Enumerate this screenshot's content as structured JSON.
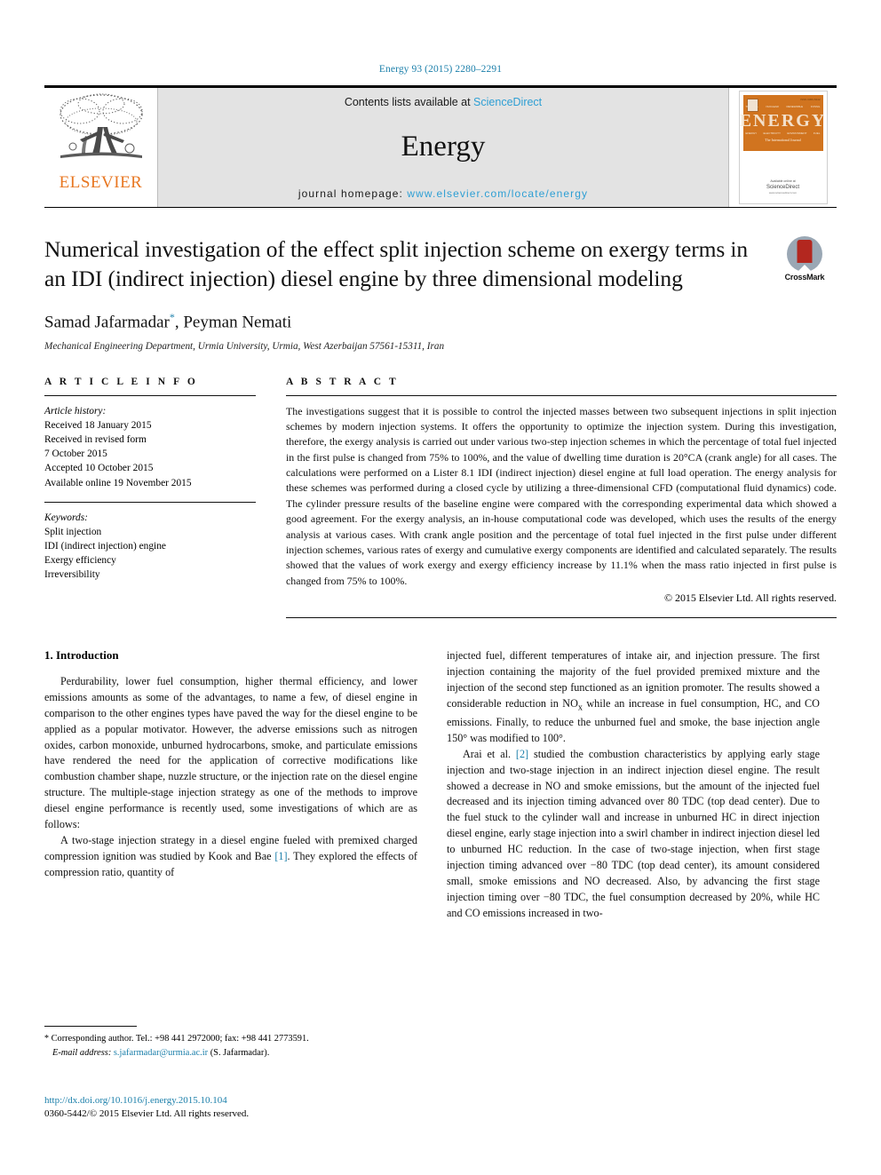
{
  "running_head": "Energy 93 (2015) 2280–2291",
  "masthead": {
    "publisher": "ELSEVIER",
    "contents_prefix": "Contents lists available at ",
    "contents_link": "ScienceDirect",
    "journal_name": "Energy",
    "homepage_prefix": "journal homepage: ",
    "homepage_url": "www.elsevier.com/locate/energy",
    "cover": {
      "title": "ENERGY",
      "tagline": "The International Journal",
      "issn": "ISSN 0360-5442",
      "available_at": "Available online at",
      "provider": "ScienceDirect",
      "provider_sub": "www.sciencedirect.com",
      "col_labels_top": [
        "THERMAL",
        "NUCLEAR",
        "RENEWABLE",
        "FOSSIL"
      ],
      "col_labels_bottom": [
        "ENERGY",
        "ELECTRICITY",
        "ENVIRONMENT",
        "FUEL"
      ]
    }
  },
  "article": {
    "title": "Numerical investigation of the effect split injection scheme on exergy terms in an IDI (indirect injection) diesel engine by three dimensional modeling",
    "crossmark_label": "CrossMark",
    "authors": "Samad Jafarmadar",
    "authors_rest": ", Peyman Nemati",
    "corresponding_mark": "*",
    "affiliation": "Mechanical Engineering Department, Urmia University, Urmia, West Azerbaijan 57561-15311, Iran"
  },
  "info": {
    "heading": "A R T I C L E   I N F O",
    "history_label": "Article history:",
    "history": [
      "Received 18 January 2015",
      "Received in revised form",
      "7 October 2015",
      "Accepted 10 October 2015",
      "Available online 19 November 2015"
    ],
    "keywords_label": "Keywords:",
    "keywords": [
      "Split injection",
      "IDI (indirect injection) engine",
      "Exergy efficiency",
      "Irreversibility"
    ]
  },
  "abstract": {
    "heading": "A B S T R A C T",
    "text": "The investigations suggest that it is possible to control the injected masses between two subsequent injections in split injection schemes by modern injection systems. It offers the opportunity to optimize the injection system. During this investigation, therefore, the exergy analysis is carried out under various two-step injection schemes in which the percentage of total fuel injected in the first pulse is changed from 75% to 100%, and the value of dwelling time duration is 20°CA (crank angle) for all cases. The calculations were performed on a Lister 8.1 IDI (indirect injection) diesel engine at full load operation. The energy analysis for these schemes was performed during a closed cycle by utilizing a three-dimensional CFD (computational fluid dynamics) code. The cylinder pressure results of the baseline engine were compared with the corresponding experimental data which showed a good agreement. For the exergy analysis, an in-house computational code was developed, which uses the results of the energy analysis at various cases. With crank angle position and the percentage of total fuel injected in the first pulse under different injection schemes, various rates of exergy and cumulative exergy components are identified and calculated separately. The results showed that the values of work exergy and exergy efficiency increase by 11.1% when the mass ratio injected in first pulse is changed from 75% to 100%.",
    "copyright": "© 2015 Elsevier Ltd. All rights reserved."
  },
  "body": {
    "section_number_title": "1.  Introduction",
    "left_para_1": "Perdurability, lower fuel consumption, higher thermal efficiency, and lower emissions amounts as some of the advantages, to name a few, of diesel engine in comparison to the other engines types have paved the way for the diesel engine to be applied as a popular motivator. However, the adverse emissions such as nitrogen oxides, carbon monoxide, unburned hydrocarbons, smoke, and particulate emissions have rendered the need for the application of corrective modifications like combustion chamber shape, nuzzle structure, or the injection rate on the diesel engine structure. The multiple-stage injection strategy as one of the methods to improve diesel engine performance is recently used, some investigations of which are as follows:",
    "left_para_2_a": "A two-stage injection strategy in a diesel engine fueled with premixed charged compression ignition was studied by Kook and Bae ",
    "left_para_2_ref": "[1]",
    "left_para_2_b": ". They explored the effects of compression ratio, quantity of",
    "right_para_1_a": "injected fuel, different temperatures of intake air, and injection pressure. The first injection containing the majority of the fuel provided premixed mixture and the injection of the second step functioned as an ignition promoter. The results showed a considerable reduction in NO",
    "right_para_1_sub": "x",
    "right_para_1_b": " while an increase in fuel consumption, HC, and CO emissions. Finally, to reduce the unburned fuel and smoke, the base injection angle 150° was modified to 100°.",
    "right_para_2_a": "Arai et al. ",
    "right_para_2_ref": "[2]",
    "right_para_2_b": " studied the combustion characteristics by applying early stage injection and two-stage injection in an indirect injection diesel engine. The result showed a decrease in NO and smoke emissions, but the amount of the injected fuel decreased and its injection timing advanced over 80 TDC (top dead center). Due to the fuel stuck to the cylinder wall and increase in unburned HC in direct injection diesel engine, early stage injection into a swirl chamber in indirect injection diesel led to unburned HC reduction. In the case of two-stage injection, when first stage injection timing advanced over −80 TDC (top dead center), its amount considered small, smoke emissions and NO decreased. Also, by advancing the first stage injection timing over −80 TDC, the fuel consumption decreased by 20%, while HC and CO emissions increased in two-"
  },
  "footnote": {
    "star": "*",
    "corresponding": " Corresponding author. Tel.: +98 441 2972000; fax: +98 441 2773591.",
    "email_label": "E-mail address:",
    "email": "s.jafarmadar@urmia.ac.ir",
    "email_owner": "(S. Jafarmadar).",
    "doi": "http://dx.doi.org/10.1016/j.energy.2015.10.104",
    "issn": "0360-5442/© 2015 Elsevier Ltd. All rights reserved."
  },
  "colors": {
    "link_blue": "#1b7faa",
    "sciencedirect_blue": "#2e9fd4",
    "elsevier_orange": "#e87722",
    "cover_orange": "#d1741f"
  }
}
